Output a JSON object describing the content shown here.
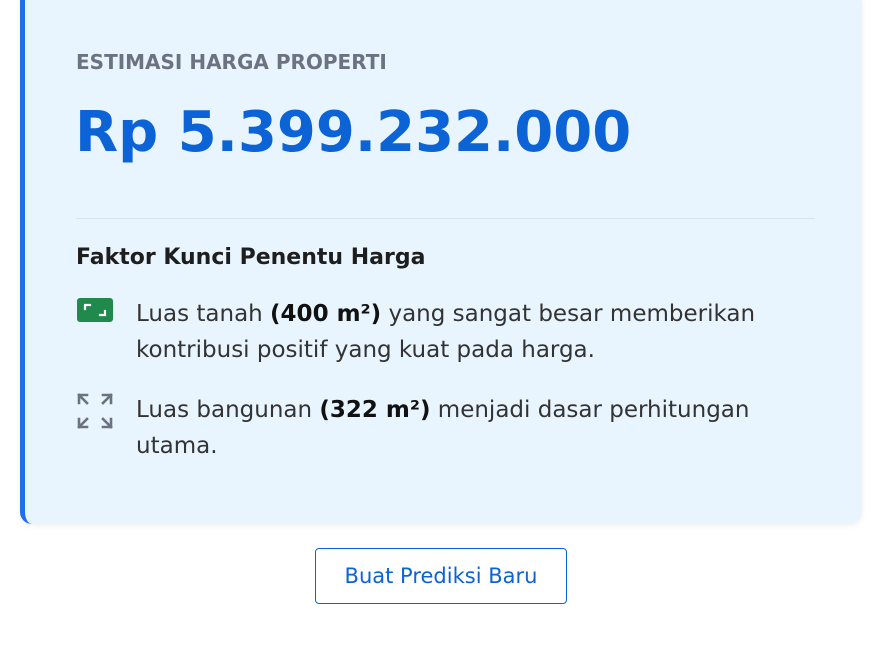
{
  "result": {
    "eyebrow": "ESTIMASI HARGA PROPERTI",
    "price": "Rp 5.399.232.000",
    "factors_title": "Faktor Kunci Penentu Harga",
    "factors": [
      {
        "icon": "land-area-icon",
        "prefix": "Luas tanah ",
        "highlight": "(400 m²)",
        "suffix": " yang sangat besar memberikan kontribusi positif yang kuat pada harga."
      },
      {
        "icon": "expand-arrows-icon",
        "prefix": "Luas bangunan ",
        "highlight": "(322 m²)",
        "suffix": " menjadi dasar perhitungan utama."
      }
    ]
  },
  "actions": {
    "new_prediction_label": "Buat Prediksi Baru"
  },
  "colors": {
    "accent": "#0b63d6",
    "card_background": "#e9f5fe",
    "land_icon": "#1f8a4c"
  }
}
